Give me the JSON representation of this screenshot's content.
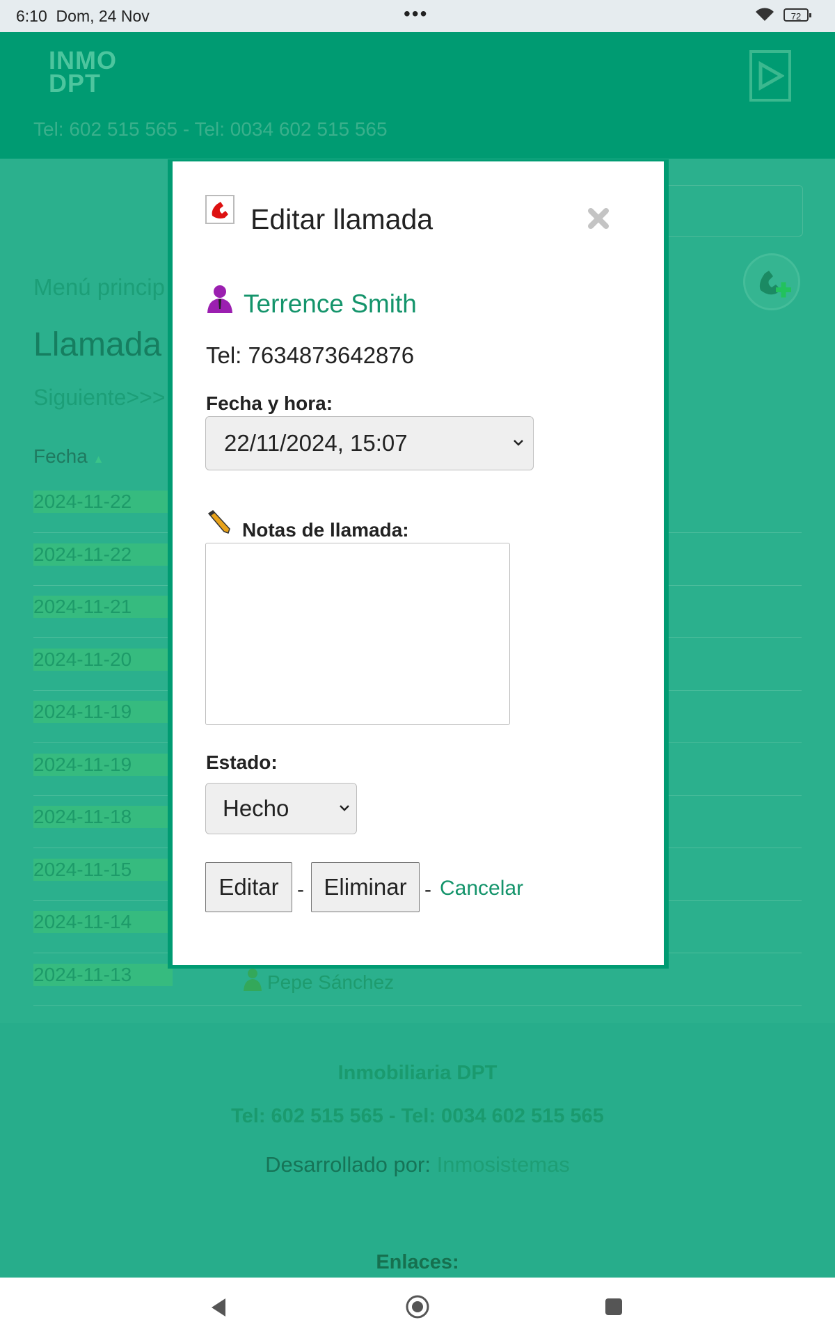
{
  "status_bar": {
    "time": "6:10",
    "date": "Dom, 24 Nov",
    "battery": "72"
  },
  "header": {
    "logo_line1": "INMO",
    "logo_line2": "DPT",
    "phone": "Tel: 602 515 565 - Tel: 0034 602 515 565"
  },
  "page": {
    "menu_link": "Menú princip",
    "title": "Llamada",
    "next_link": "Siguiente>>>",
    "column_fecha": "Fecha",
    "rows": [
      {
        "date": "2024-11-22",
        "name": ""
      },
      {
        "date": "2024-11-22",
        "name": ""
      },
      {
        "date": "2024-11-21",
        "name": ""
      },
      {
        "date": "2024-11-20",
        "name": ""
      },
      {
        "date": "2024-11-19",
        "name": ""
      },
      {
        "date": "2024-11-19",
        "name": ""
      },
      {
        "date": "2024-11-18",
        "name": ""
      },
      {
        "date": "2024-11-15",
        "name": ""
      },
      {
        "date": "2024-11-14",
        "name": ""
      },
      {
        "date": "2024-11-13",
        "name": "Pepe Sánchez"
      }
    ]
  },
  "footer": {
    "company": "Inmobiliaria DPT",
    "phones": "Tel: 602 515 565 - Tel: 0034 602 515 565",
    "developed_by": "Desarrollado por:",
    "developer": "Inmosistemas",
    "links": "Enlaces:"
  },
  "modal": {
    "title": "Editar llamada",
    "contact_name": "Terrence Smith",
    "tel": "Tel: 7634873642876",
    "datetime_label": "Fecha y hora:",
    "datetime_value": "22/11/2024, 15:07",
    "notes_label": "Notas de llamada:",
    "notes_value": "",
    "state_label": "Estado:",
    "state_value": "Hecho",
    "edit_button": "Editar",
    "delete_button": "Eliminar",
    "separator": "-",
    "cancel_link": "Cancelar"
  },
  "colors": {
    "brand": "#009b72",
    "link": "#14946b"
  }
}
